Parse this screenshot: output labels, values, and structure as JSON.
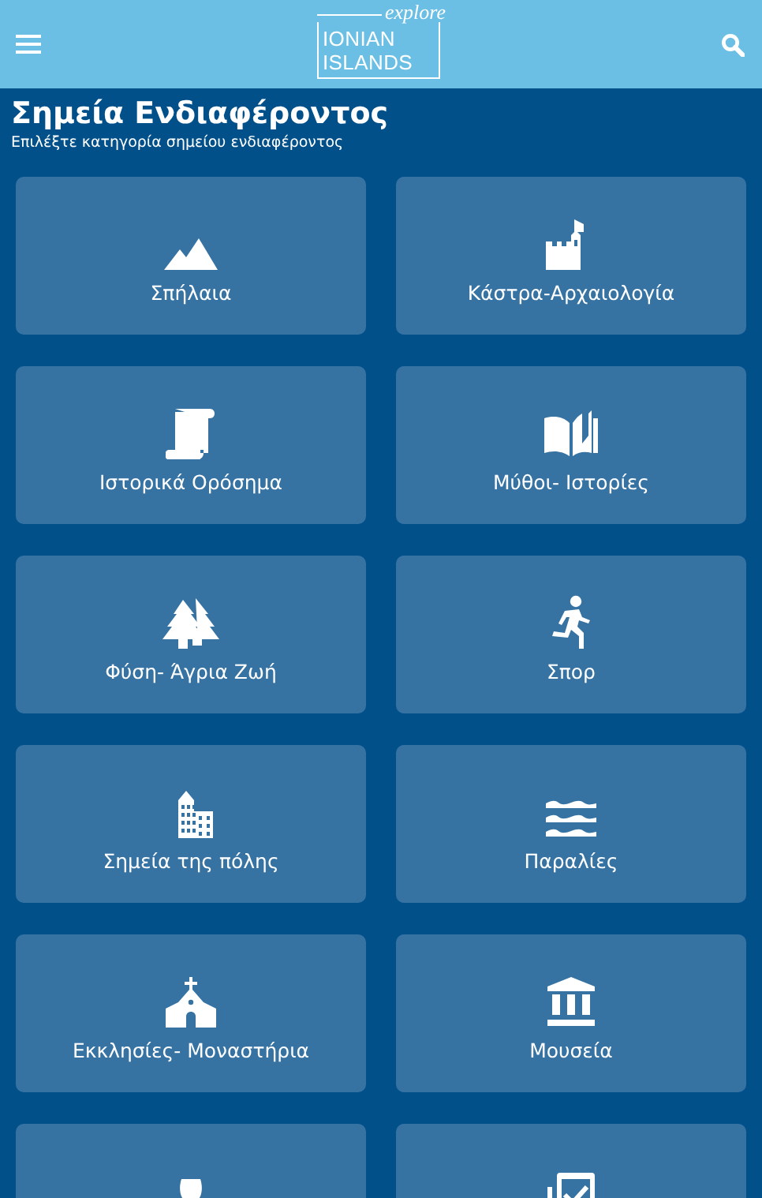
{
  "header": {
    "logo": {
      "small": "explore",
      "line_1": "IONIAN",
      "line_2": "ISLANDS"
    }
  },
  "page": {
    "title": "Σημεία Ενδιαφέροντος",
    "subtitle": "Επιλέξτε κατηγορία σημείου ενδιαφέροντος"
  },
  "categories": [
    {
      "kind": "mountains",
      "label": "Σπήλαια"
    },
    {
      "kind": "castle",
      "label": "Κάστρα-Αρχαιολογία"
    },
    {
      "kind": "scroll",
      "label": "Ιστορικά Ορόσημα"
    },
    {
      "kind": "book",
      "label": "Μύθοι- Ιστορίες"
    },
    {
      "kind": "trees",
      "label": "Φύση- Άγρια Ζωή"
    },
    {
      "kind": "runner",
      "label": "Σπορ"
    },
    {
      "kind": "building",
      "label": "Σημεία της πόλης"
    },
    {
      "kind": "waves",
      "label": "Παραλίες"
    },
    {
      "kind": "church",
      "label": "Εκκλησίες- Μοναστήρια"
    },
    {
      "kind": "museum",
      "label": "Μουσεία"
    },
    {
      "kind": "wine"
    },
    {
      "kind": "checklist"
    }
  ]
}
